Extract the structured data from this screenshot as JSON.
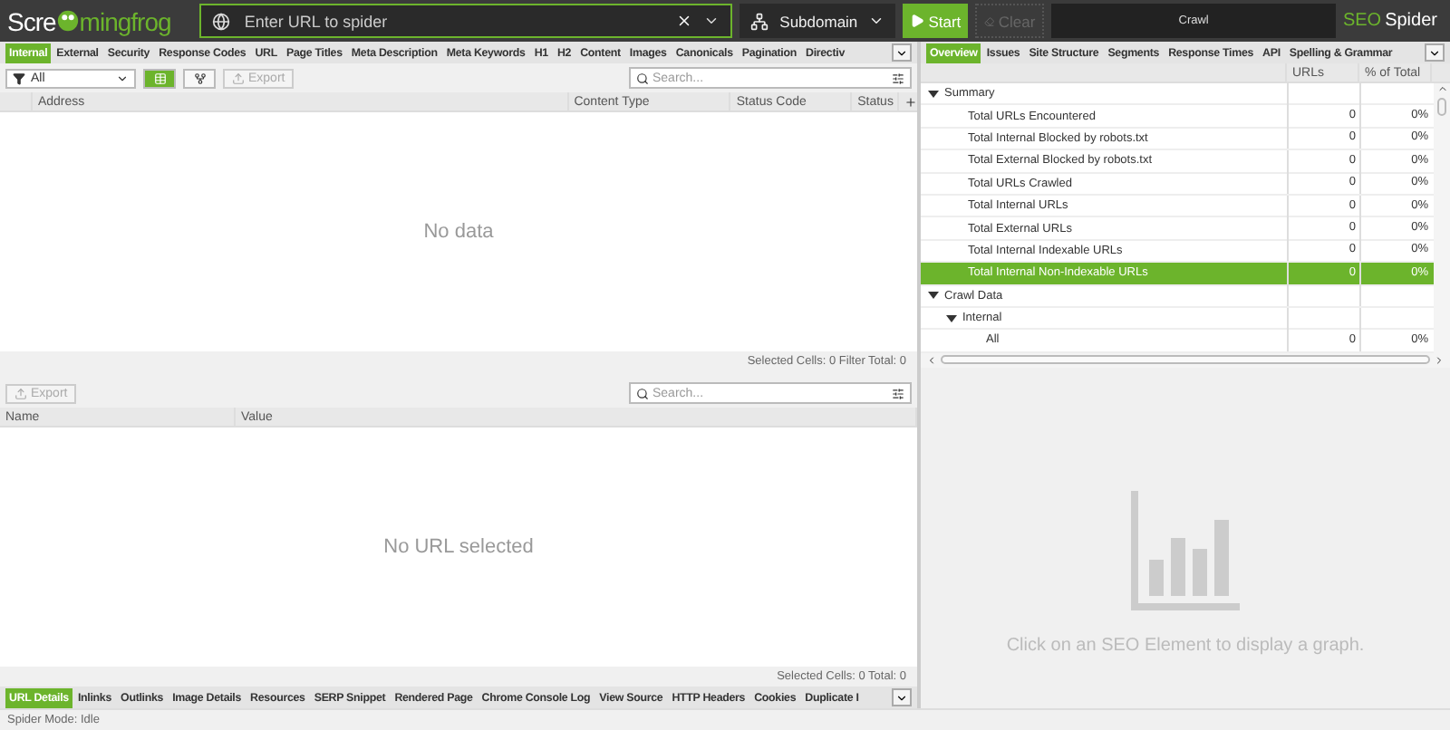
{
  "header": {
    "logo_start": "Scre",
    "logo_end": "mingfrog",
    "url_placeholder": "Enter URL to spider",
    "mode": "Subdomain",
    "start": "Start",
    "clear": {
      "label": "Clear",
      "disabled": true
    },
    "crawl": {
      "label": "Crawl",
      "level": 0
    },
    "brand_accent": "SEO",
    "brand": "Spider"
  },
  "left_tabs": [
    {
      "label": "Internal",
      "selected": true
    },
    {
      "label": "External",
      "selected": false
    },
    {
      "label": "Security",
      "selected": false
    },
    {
      "label": "Response Codes",
      "selected": false
    },
    {
      "label": "URL",
      "selected": false
    },
    {
      "label": "Page Titles",
      "selected": false
    },
    {
      "label": "Meta Description",
      "selected": false
    },
    {
      "label": "Meta Keywords",
      "selected": false
    },
    {
      "label": "H1",
      "selected": false
    },
    {
      "label": "H2",
      "selected": false
    },
    {
      "label": "Content",
      "selected": false
    },
    {
      "label": "Images",
      "selected": false
    },
    {
      "label": "Canonicals",
      "selected": false
    },
    {
      "label": "Pagination",
      "selected": false
    },
    {
      "label": "Directiv",
      "selected": false
    }
  ],
  "top_pane": {
    "filter": "All",
    "views": [
      {
        "kind": "list",
        "selected": true
      },
      {
        "kind": "tree",
        "selected": false
      }
    ],
    "export": {
      "label": "Export",
      "disabled": true
    },
    "search_placeholder": "Search...",
    "columns": [
      "Address",
      "Content Type",
      "Status Code",
      "Status"
    ],
    "empty": "No data",
    "footer": "Selected Cells: 0  Filter Total: 0"
  },
  "lower_pane": {
    "export": {
      "label": "Export",
      "disabled": true
    },
    "search_placeholder": "Search...",
    "columns": [
      "Name",
      "Value"
    ],
    "empty": "No URL selected",
    "footer": "Selected Cells: 0  Total: 0"
  },
  "bottom_tabs": [
    {
      "label": "URL Details",
      "selected": true
    },
    {
      "label": "Inlinks",
      "selected": false
    },
    {
      "label": "Outlinks",
      "selected": false
    },
    {
      "label": "Image Details",
      "selected": false
    },
    {
      "label": "Resources",
      "selected": false
    },
    {
      "label": "SERP Snippet",
      "selected": false
    },
    {
      "label": "Rendered Page",
      "selected": false
    },
    {
      "label": "Chrome Console Log",
      "selected": false
    },
    {
      "label": "View Source",
      "selected": false
    },
    {
      "label": "HTTP Headers",
      "selected": false
    },
    {
      "label": "Cookies",
      "selected": false
    },
    {
      "label": "Duplicate I",
      "selected": false
    }
  ],
  "right_tabs": [
    {
      "label": "Overview",
      "selected": true
    },
    {
      "label": "Issues",
      "selected": false
    },
    {
      "label": "Site Structure",
      "selected": false
    },
    {
      "label": "Segments",
      "selected": false
    },
    {
      "label": "Response Times",
      "selected": false
    },
    {
      "label": "API",
      "selected": false
    },
    {
      "label": "Spelling & Grammar",
      "selected": false
    }
  ],
  "overview": {
    "columns": [
      "URLs",
      "% of Total"
    ],
    "tree": [
      {
        "label": "Summary",
        "expanded": true,
        "selected": false,
        "children": [
          {
            "label": "Total URLs Encountered",
            "urls": "0",
            "percent": "0%",
            "selected": false
          },
          {
            "label": "Total Internal Blocked by robots.txt",
            "urls": "0",
            "percent": "0%",
            "selected": false
          },
          {
            "label": "Total External Blocked by robots.txt",
            "urls": "0",
            "percent": "0%",
            "selected": false
          },
          {
            "label": "Total URLs Crawled",
            "urls": "0",
            "percent": "0%",
            "selected": false
          },
          {
            "label": "Total Internal URLs",
            "urls": "0",
            "percent": "0%",
            "selected": false
          },
          {
            "label": "Total External URLs",
            "urls": "0",
            "percent": "0%",
            "selected": false
          },
          {
            "label": "Total Internal Indexable URLs",
            "urls": "0",
            "percent": "0%",
            "selected": false
          },
          {
            "label": "Total Internal Non-Indexable URLs",
            "urls": "0",
            "percent": "0%",
            "selected": true
          }
        ]
      },
      {
        "label": "Crawl Data",
        "expanded": true,
        "selected": false,
        "children": [
          {
            "label": "Internal",
            "expanded": true,
            "selected": false,
            "children": [
              {
                "label": "All",
                "urls": "0",
                "percent": "0%",
                "selected": false
              }
            ]
          }
        ]
      }
    ]
  },
  "graph_hint": "Click on an SEO Element to display a graph.",
  "status": "Spider Mode: Idle"
}
